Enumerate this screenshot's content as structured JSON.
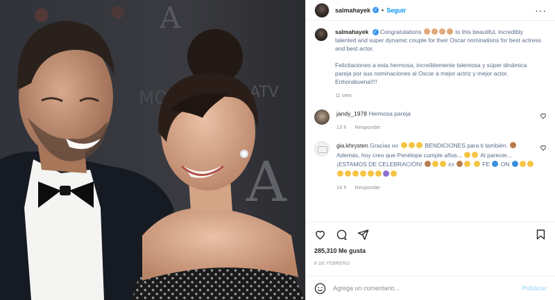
{
  "post": {
    "username": "salmahayek",
    "follow_label": "Seguir",
    "verified_icon": "verified-badge-icon",
    "more_icon": "more-options-icon"
  },
  "caption": {
    "username": "salmahayek",
    "text_en_1": "Congratulations",
    "text_en_2": "to this beautiful, incredibly talented and super dynamic couple for their Oscar nominations for best actress and best actor.",
    "text_es": "Felicitaciones a esta hermosa, increíblemente talentosa y súper dinámica pareja por sus nominaciones al Oscar a mejor actriz y mejor actor. Enhorabuena!!!!",
    "time": "11 sem"
  },
  "comments": [
    {
      "username": "jandy_1978",
      "text": "Hermosa pareja",
      "time": "13 h",
      "reply_label": "Responder"
    },
    {
      "username": "gia.khrysten",
      "text_a": "Gracias",
      "flag": "MX",
      "text_b": "BENDICIONES para ti también.",
      "text_c": "Además, hoy creo que Penélope cumple años...",
      "text_d": "Al parecer... ¡ESTAMOS DE CELEBRACIÓN!",
      "flag2": "ES",
      "text_e": "FE",
      "text_f": "ON",
      "time": "14 h",
      "reply_label": "Responder"
    }
  ],
  "actions": {
    "likes": "285,310 Me gusta",
    "date": "8 DE FEBRERO"
  },
  "add_comment": {
    "placeholder": "Agrega un comentario...",
    "publish_label": "Publicar"
  },
  "colors": {
    "accent": "#0095f6",
    "verified": "#3897f0",
    "muted": "#8e8e8e",
    "publish_disabled": "#b2dffc"
  }
}
